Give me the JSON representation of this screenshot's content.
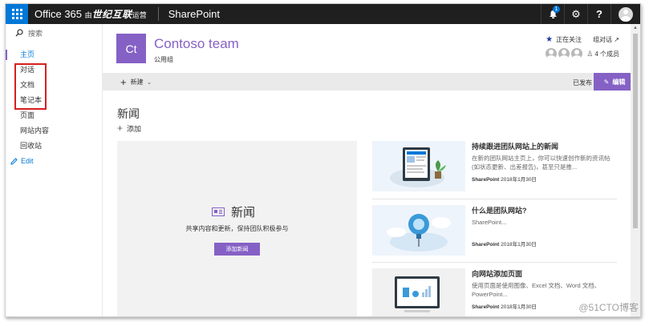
{
  "suite": {
    "brand_prefix": "Office 365",
    "brand_by": "由",
    "brand_operator": "世纪互联",
    "brand_suffix": "运营",
    "app_name": "SharePoint",
    "notification_count": "1",
    "gear": "⚙",
    "help": "?"
  },
  "nav": {
    "search_label": "搜索",
    "items": [
      "主页",
      "对话",
      "文档",
      "笔记本",
      "页面",
      "网站内容",
      "回收站"
    ],
    "edit_label": "Edit"
  },
  "site": {
    "logo_text": "Ct",
    "title": "Contoso team",
    "subtitle": "公用组",
    "follow_label": "正在关注",
    "share_label": "组对话 ↗",
    "members_label": "4 个成员"
  },
  "cmdbar": {
    "new_label": "新建",
    "published_label": "已发布",
    "edit_label": "编辑"
  },
  "news": {
    "section_title": "新闻",
    "add_label": "添加",
    "hero_title": "新闻",
    "hero_desc": "共享内容和更新，保持团队积极参与",
    "hero_button": "添加新闻",
    "items": [
      {
        "title": "持续跟进团队网站上的新闻",
        "desc": "在新的团队网站主页上，你可以快速创作新的资讯帖(如状态更新、出差报告)，甚至只是推...",
        "source": "SharePoint",
        "date": "2018年1月30日"
      },
      {
        "title": "什么是团队网站?",
        "desc": "SharePoint...",
        "source": "SharePoint",
        "date": "2018年1月30日"
      },
      {
        "title": "向网站添加页面",
        "desc": "使用页面是使用图像、Excel 文档、Word 文档、PowerPoint...",
        "source": "SharePoint",
        "date": "2018年1月30日"
      }
    ]
  },
  "watermark": "@51CTO博客",
  "colors": {
    "accent": "#8561c5",
    "suite_bg": "#1f1f1f",
    "waffle_bg": "#0078d7",
    "highlight": "#d61f1f"
  }
}
